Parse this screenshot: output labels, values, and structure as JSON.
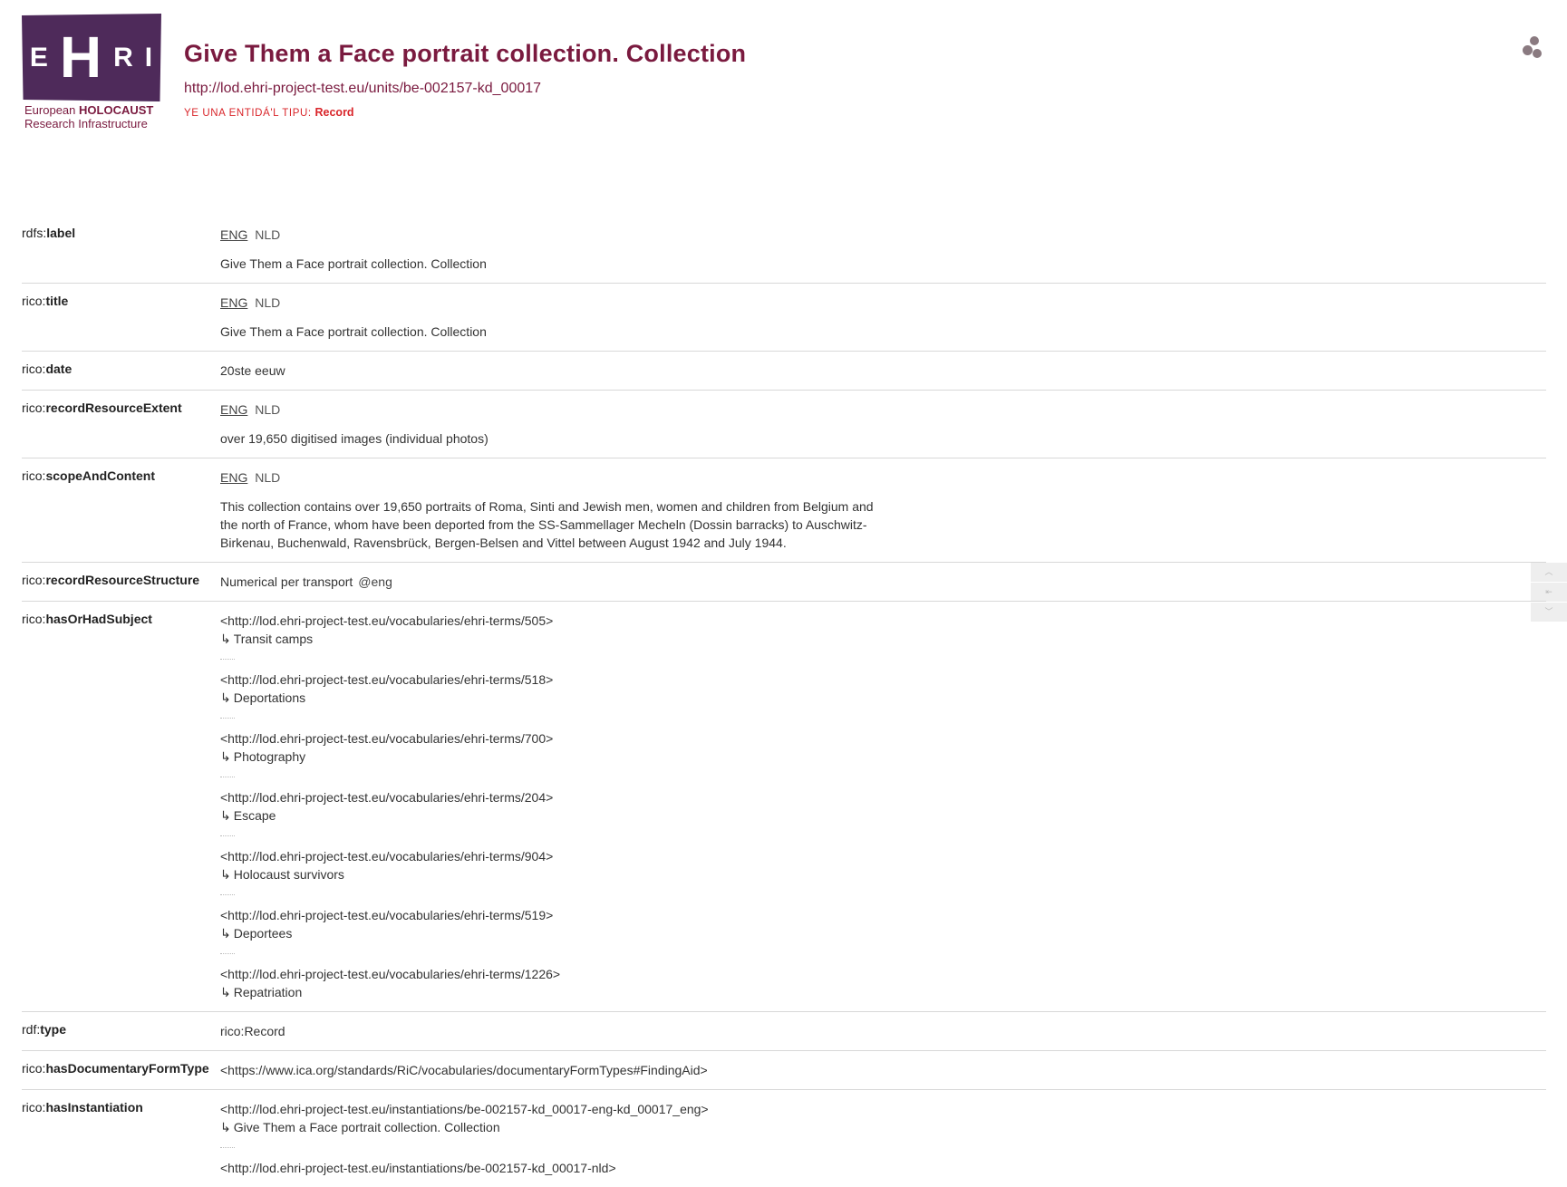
{
  "logo": {
    "letters": [
      "E",
      "H",
      "R",
      "I"
    ],
    "line1_prefix": "European",
    "line1_bold": "HOLOCAUST",
    "line2": "Research Infrastructure"
  },
  "header": {
    "title": "Give Them a Face portrait collection. Collection",
    "uri": "http://lod.ehri-project-test.eu/units/be-002157-kd_00017",
    "type_label": "ye una entidá'l tipu:",
    "type_value": "Record"
  },
  "menu_icon": "dots-menu-icon",
  "side_controls": [
    "︿",
    "⇤",
    "﹀"
  ],
  "properties": {
    "label": {
      "prefix": "rdfs:",
      "name": "label",
      "langs": [
        "ENG",
        "NLD"
      ],
      "value": "Give Them a Face portrait collection. Collection"
    },
    "title": {
      "prefix": "rico:",
      "name": "title",
      "langs": [
        "ENG",
        "NLD"
      ],
      "value": "Give Them a Face portrait collection. Collection"
    },
    "date": {
      "prefix": "rico:",
      "name": "date",
      "value": "20ste eeuw"
    },
    "extent": {
      "prefix": "rico:",
      "name": "recordResourceExtent",
      "langs": [
        "ENG",
        "NLD"
      ],
      "value": "over 19,650 digitised images (individual photos)"
    },
    "scope": {
      "prefix": "rico:",
      "name": "scopeAndContent",
      "langs": [
        "ENG",
        "NLD"
      ],
      "value": "This collection contains over 19,650 portraits of Roma, Sinti and Jewish men, women and children from Belgium and the north of France, whom have been deported from the SS-Sammellager Mecheln (Dossin barracks) to Auschwitz-Birkenau, Buchenwald, Ravensbrück, Bergen-Belsen and Vittel between August 1942 and July 1944."
    },
    "structure": {
      "prefix": "rico:",
      "name": "recordResourceStructure",
      "value": "Numerical per transport",
      "lang_tag": "@eng"
    },
    "subject": {
      "prefix": "rico:",
      "name": "hasOrHadSubject",
      "items": [
        {
          "uri": "<http://lod.ehri-project-test.eu/vocabularies/ehri-terms/505>",
          "label": "Transit camps"
        },
        {
          "uri": "<http://lod.ehri-project-test.eu/vocabularies/ehri-terms/518>",
          "label": "Deportations"
        },
        {
          "uri": "<http://lod.ehri-project-test.eu/vocabularies/ehri-terms/700>",
          "label": "Photography"
        },
        {
          "uri": "<http://lod.ehri-project-test.eu/vocabularies/ehri-terms/204>",
          "label": "Escape"
        },
        {
          "uri": "<http://lod.ehri-project-test.eu/vocabularies/ehri-terms/904>",
          "label": "Holocaust survivors"
        },
        {
          "uri": "<http://lod.ehri-project-test.eu/vocabularies/ehri-terms/519>",
          "label": "Deportees"
        },
        {
          "uri": "<http://lod.ehri-project-test.eu/vocabularies/ehri-terms/1226>",
          "label": "Repatriation"
        }
      ]
    },
    "type": {
      "prefix": "rdf:",
      "name": "type",
      "value": "rico:Record"
    },
    "formtype": {
      "prefix": "rico:",
      "name": "hasDocumentaryFormType",
      "value": "<https://www.ica.org/standards/RiC/vocabularies/documentaryFormTypes#FindingAid>"
    },
    "instantiation": {
      "prefix": "rico:",
      "name": "hasInstantiation",
      "items": [
        {
          "uri": "<http://lod.ehri-project-test.eu/instantiations/be-002157-kd_00017-eng-kd_00017_eng>",
          "label": "Give Them a Face portrait collection. Collection"
        },
        {
          "uri": "<http://lod.ehri-project-test.eu/instantiations/be-002157-kd_00017-nld>",
          "label": ""
        }
      ]
    }
  }
}
